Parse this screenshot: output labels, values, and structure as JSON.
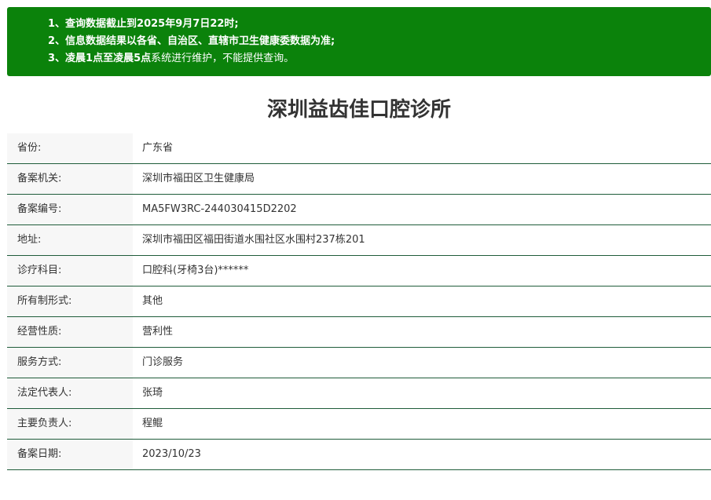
{
  "notice": {
    "lines": [
      {
        "parts": [
          {
            "text": "1、查询数据截止到2025年9月7日22时;",
            "bold": true
          }
        ]
      },
      {
        "parts": [
          {
            "text": "2、信息数据结果以各省、自治区、直辖市卫生健康委数据为准;",
            "bold": true
          }
        ]
      },
      {
        "parts": [
          {
            "text": "3、凌晨1点至凌晨5点",
            "bold": true
          },
          {
            "text": "系统进行维护，不能提供查询。",
            "bold": false
          }
        ]
      }
    ]
  },
  "title": "深圳益齿佳口腔诊所",
  "rows": [
    {
      "label": "省份:",
      "value": "广东省"
    },
    {
      "label": "备案机关:",
      "value": "深圳市福田区卫生健康局"
    },
    {
      "label": "备案编号:",
      "value": "MA5FW3RC-244030415D2202"
    },
    {
      "label": "地址:",
      "value": "深圳市福田区福田街道水围社区水围村237栋201"
    },
    {
      "label": "诊疗科目:",
      "value": "口腔科(牙椅3台)******"
    },
    {
      "label": "所有制形式:",
      "value": "其他"
    },
    {
      "label": "经营性质:",
      "value": "营利性"
    },
    {
      "label": "服务方式:",
      "value": "门诊服务"
    },
    {
      "label": "法定代表人:",
      "value": "张琦"
    },
    {
      "label": "主要负责人:",
      "value": "程鲲"
    },
    {
      "label": "备案日期:",
      "value": "2023/10/23"
    }
  ],
  "colors": {
    "notice_bg": "#0b820b",
    "row_border": "#1f5c3a",
    "label_bg": "#f7f7f7"
  }
}
